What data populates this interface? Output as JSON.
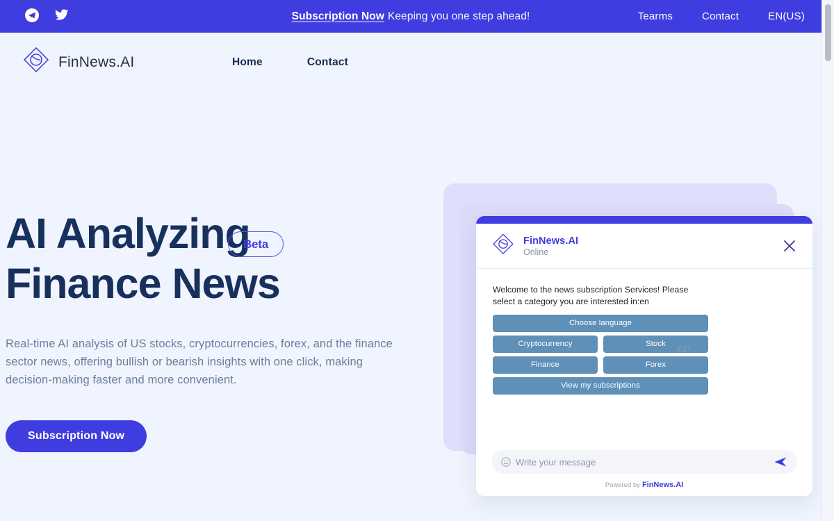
{
  "announcement": {
    "social": [
      {
        "name": "telegram-icon",
        "label": "Telegram"
      },
      {
        "name": "twitter-icon",
        "label": "Twitter"
      }
    ],
    "link_label": "Subscription Now",
    "tagline": "Keeping you one step ahead!",
    "links": [
      {
        "label": "Tearms"
      },
      {
        "label": "Contact"
      },
      {
        "label": "EN(US)"
      }
    ],
    "background": "#3f3ce0"
  },
  "header": {
    "brand": "FinNews.AI",
    "nav": [
      {
        "label": "Home"
      },
      {
        "label": "Contact"
      }
    ]
  },
  "hero": {
    "heading_line1": "AI Analyzing",
    "heading_line2": "Finance News",
    "badge": "Beta",
    "subtitle": "Real-time AI analysis of US stocks, cryptocurrencies, forex, and the finance sector news, offering bullish or bearish insights with one click, making decision-making faster and more convenient.",
    "cta_label": "Subscription Now",
    "accent": "#3f3ce0",
    "heading_color": "#18305c"
  },
  "chat_widget": {
    "brand": "FinNews.AI",
    "status": "Online",
    "close_label": "×",
    "message": "Welcome to the news subscription Services! Please select a category you are interested in:en",
    "timestamp": "2:37",
    "quick_replies": {
      "top": "Choose language",
      "row1": [
        "Cryptocurrency",
        "Stock"
      ],
      "row2": [
        "Finance",
        "Forex"
      ],
      "bottom": "View my subscriptions"
    },
    "composer_placeholder": "Write your message",
    "composer_value": "",
    "powered_by_prefix": "Powered by",
    "powered_by_brand": "FinNews.AI",
    "button_color": "#5f90b8",
    "accent": "#3f3ce0"
  }
}
